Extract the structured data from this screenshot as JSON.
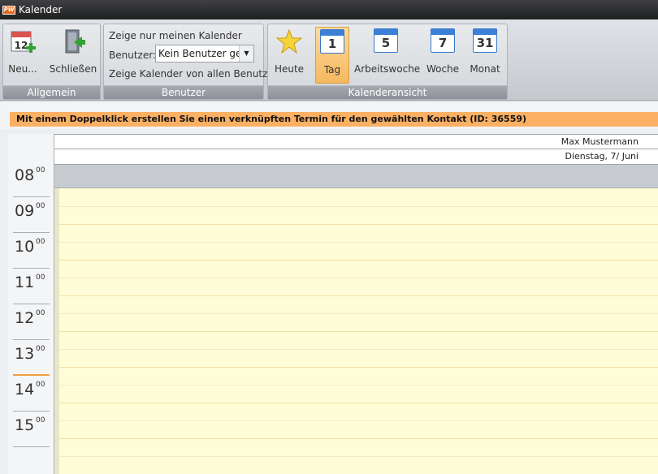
{
  "window": {
    "title": "Kalender",
    "logo_text": "PW"
  },
  "ribbon": {
    "groups": {
      "allgemein": "Allgemein",
      "benutzer": "Benutzer",
      "kalenderansicht": "Kalenderansicht"
    },
    "neu_label": "Neu...",
    "schliessen_label": "Schließen",
    "neu_icon_num": "12",
    "zeige_nur_meinen": "Zeige nur meinen Kalender",
    "benutzer_label": "Benutzer:",
    "benutzer_select": "Kein Benutzer gew",
    "zeige_alle": "Zeige Kalender von allen Benutzern",
    "heute_label": "Heute",
    "tag_label": "Tag",
    "tag_num": "1",
    "arbeitswoche_label": "Arbeitswoche",
    "arbeitswoche_num": "5",
    "woche_label": "Woche",
    "woche_num": "7",
    "monat_label": "Monat",
    "monat_num": "31"
  },
  "info_message": "Mit einem Doppelklick erstellen Sie einen verknüpften Termin für den gewählten Kontakt (ID: 36559)",
  "calendar": {
    "resource_name": "Max Mustermann",
    "date_header": "Dienstag, 7/ Juni",
    "hours": [
      {
        "h": "08",
        "m": "00"
      },
      {
        "h": "09",
        "m": "00"
      },
      {
        "h": "10",
        "m": "00"
      },
      {
        "h": "11",
        "m": "00"
      },
      {
        "h": "12",
        "m": "00"
      },
      {
        "h": "13",
        "m": "00"
      },
      {
        "h": "14",
        "m": "00"
      },
      {
        "h": "15",
        "m": "00"
      }
    ]
  },
  "colors": {
    "accent_orange": "#fbb064",
    "active_button": "#f6b860",
    "grid_background": "#fffcd8"
  }
}
